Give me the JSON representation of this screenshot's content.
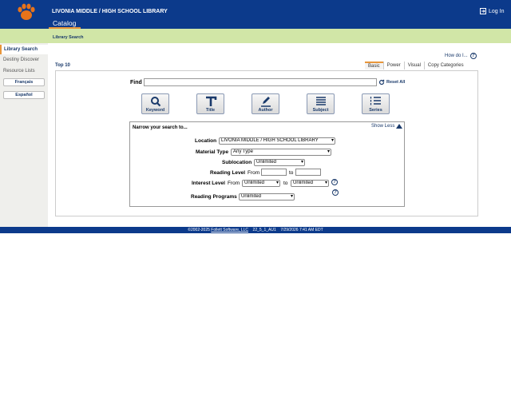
{
  "header": {
    "library_name": "LIVONIA MIDDLE / HIGH SCHOOL LIBRARY",
    "login_label": "Log In",
    "tab_label": "Catalog",
    "subnav_label": "Library Search",
    "bg_color": "#0c3a8b",
    "accent_color": "#e8963a",
    "logo_icon": "paw-icon"
  },
  "sidebar": {
    "items": [
      {
        "label": "Library Search"
      },
      {
        "label": "Destiny Discover"
      },
      {
        "label": "Resource Lists"
      }
    ],
    "languages": [
      "Français",
      "Español"
    ]
  },
  "toolbar": {
    "howdo_label": "How do I...",
    "top10_label": "Top 10",
    "tabs": [
      "Basic",
      "Power",
      "Visual",
      "Copy Categories"
    ]
  },
  "search": {
    "find_label": "Find",
    "find_value": "",
    "reset_label": "Reset All",
    "buttons": [
      "Keyword",
      "Title",
      "Author",
      "Subject",
      "Series"
    ]
  },
  "narrow": {
    "title": "Narrow your search to...",
    "show_less_label": "Show Less",
    "location_label": "Location",
    "location_value": "LIVONIA MIDDLE / HIGH SCHOOL LIBRARY",
    "material_label": "Material Type",
    "material_value": "Any Type",
    "sublocation_label": "Sublocation",
    "sublocation_value": "Unlimited",
    "reading_level_label": "Reading Level",
    "from_label": "From",
    "to_label": "to",
    "interest_label": "Interest Level",
    "interest_from": "Unlimited",
    "interest_to": "Unlimited",
    "reading_programs_label": "Reading Programs",
    "reading_programs_value": "Unlimited"
  },
  "footer": {
    "copyright": "©2002-2025",
    "company": "Follett Software, LLC",
    "version": "22_5_1_AU1",
    "timestamp": "7/29/2026 7:41 AM EDT"
  }
}
